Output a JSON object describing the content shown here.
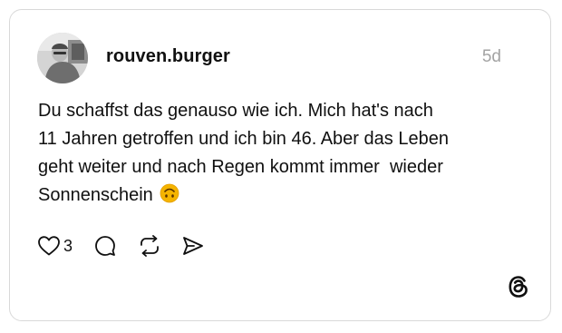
{
  "post": {
    "username": "rouven.burger",
    "timestamp": "5d",
    "text_line_1": "Du schaffst das genauso wie ich. Mich hat's nach",
    "text_line_2": "11 Jahren getroffen und ich bin 46. Aber das Leben",
    "text_line_3": "geht weiter und nach Regen kommt immer  wieder",
    "text_line_4": "Sonnenschein",
    "emoji": "upside-down-face-emoji"
  },
  "actions": {
    "like_icon": "heart-icon",
    "like_count": "3",
    "reply_icon": "comment-icon",
    "repost_icon": "repost-icon",
    "share_icon": "send-icon"
  },
  "branding": {
    "logo_icon": "threads-logo-icon"
  },
  "colors": {
    "text": "#101010",
    "muted": "#a3a3a3",
    "border": "#d9d9d9",
    "emoji": "#f5b400"
  }
}
